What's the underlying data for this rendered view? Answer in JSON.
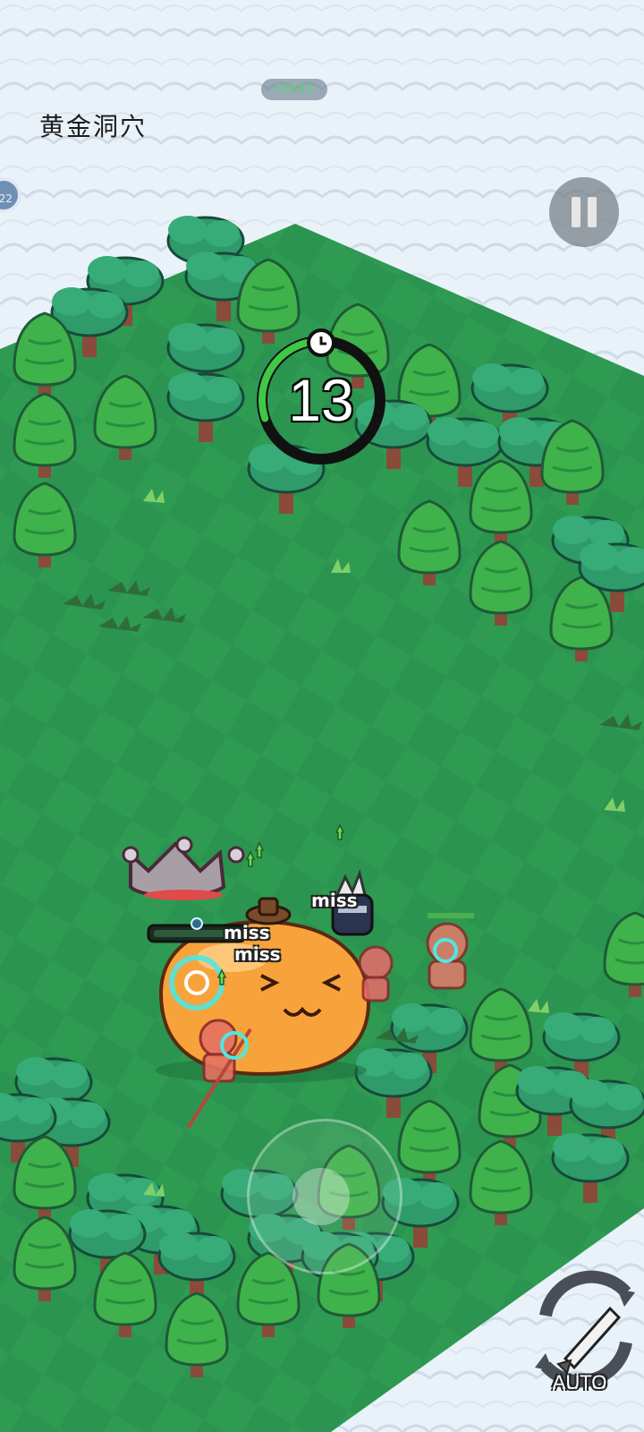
{
  "hud": {
    "fps_label": "FPS45",
    "level_name": "黄金洞穴",
    "side_badge": "22",
    "timer_value": "13",
    "timer_progress": 0.3,
    "auto_label": "AUTO"
  },
  "combat_texts": [
    "miss",
    "miss",
    "miss"
  ],
  "icons": [
    "pause-icon",
    "clock-icon",
    "auto-battle-icon",
    "crown-icon",
    "joystick-icon"
  ],
  "colors": {
    "grass": "#2e9a52",
    "grass_dark": "#258847",
    "cloud": "#eaf2f9",
    "timer_green": "#3fc844",
    "boss_orange": "#f7a23a",
    "crown": "#a79ea6"
  }
}
